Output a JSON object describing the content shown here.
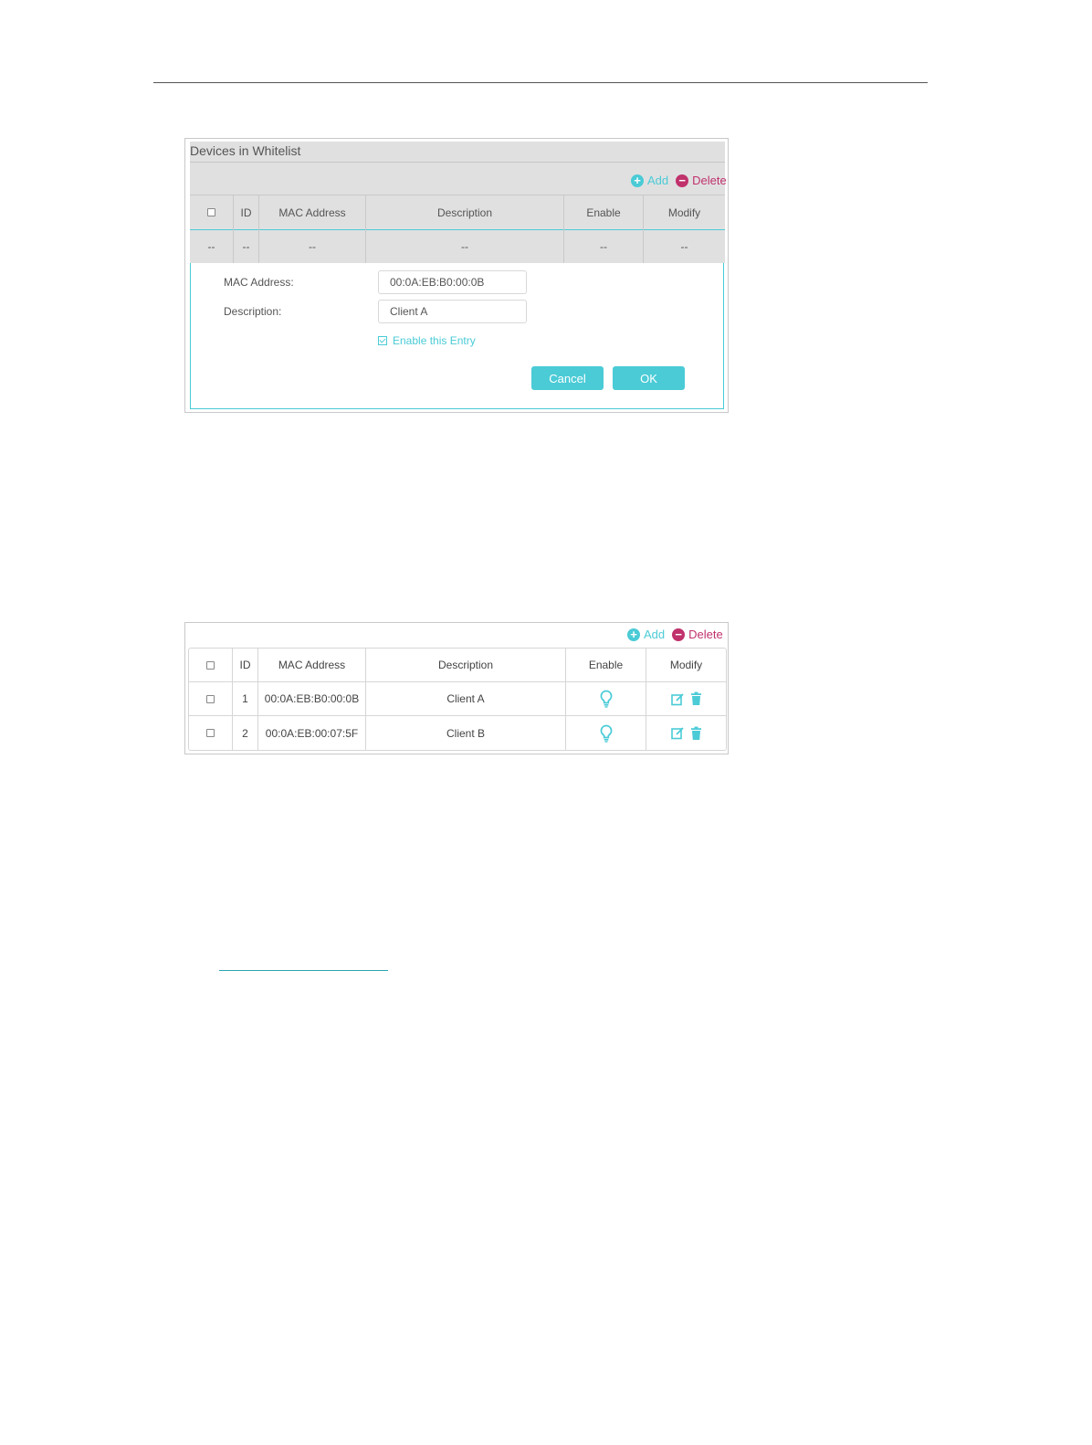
{
  "colors": {
    "accent": "#4acbd6",
    "delete": "#c0326c"
  },
  "panel1": {
    "title": "Devices in Whitelist",
    "toolbar": {
      "add_label": "Add",
      "delete_label": "Delete",
      "add_icon": "plus-circle-icon",
      "delete_icon": "minus-circle-icon"
    },
    "columns": [
      "ID",
      "MAC Address",
      "Description",
      "Enable",
      "Modify"
    ],
    "empty_row": [
      "--",
      "--",
      "--",
      "--",
      "--",
      "--"
    ],
    "form": {
      "mac_label": "MAC Address:",
      "mac_value": "00:0A:EB:B0:00:0B",
      "desc_label": "Description:",
      "desc_value": "Client A",
      "enable_label": "Enable this Entry",
      "cancel_label": "Cancel",
      "ok_label": "OK"
    }
  },
  "panel2": {
    "toolbar": {
      "add_label": "Add",
      "delete_label": "Delete"
    },
    "columns": [
      "ID",
      "MAC Address",
      "Description",
      "Enable",
      "Modify"
    ],
    "rows": [
      {
        "id": "1",
        "mac": "00:0A:EB:B0:00:0B",
        "description": "Client A",
        "enable_icon": "bulb-icon",
        "modify_icons": [
          "edit-icon",
          "trash-icon"
        ]
      },
      {
        "id": "2",
        "mac": "00:0A:EB:00:07:5F",
        "description": "Client B",
        "enable_icon": "bulb-icon",
        "modify_icons": [
          "edit-icon",
          "trash-icon"
        ]
      }
    ]
  }
}
